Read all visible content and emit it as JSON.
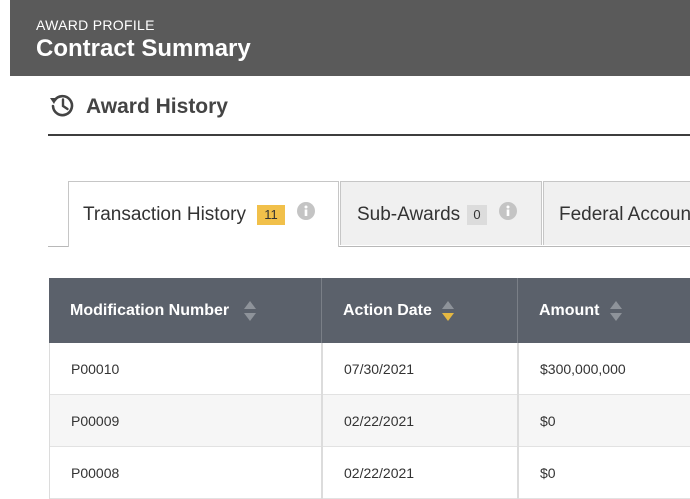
{
  "header": {
    "eyebrow": "AWARD PROFILE",
    "title": "Contract Summary"
  },
  "section": {
    "icon": "history-icon",
    "title": "Award History"
  },
  "tabs": [
    {
      "label": "Transaction History",
      "count": "11",
      "active": true
    },
    {
      "label": "Sub-Awards",
      "count": "0",
      "active": false
    },
    {
      "label": "Federal Accoun",
      "active": false
    }
  ],
  "table": {
    "columns": [
      {
        "label": "Modification Number",
        "sort": "none"
      },
      {
        "label": "Action Date",
        "sort": "descending"
      },
      {
        "label": "Amount",
        "sort": "none"
      }
    ],
    "rows": [
      [
        "P00010",
        "07/30/2021",
        "$300,000,000"
      ],
      [
        "P00009",
        "02/22/2021",
        "$0"
      ],
      [
        "P00008",
        "02/22/2021",
        "$0"
      ]
    ]
  },
  "colors": {
    "header_bg": "#5a5a5a",
    "table_header_bg": "#5b616b",
    "badge_active": "#f1c04a",
    "badge_inactive": "#dcdcdc",
    "sort_active": "#e5b842"
  }
}
